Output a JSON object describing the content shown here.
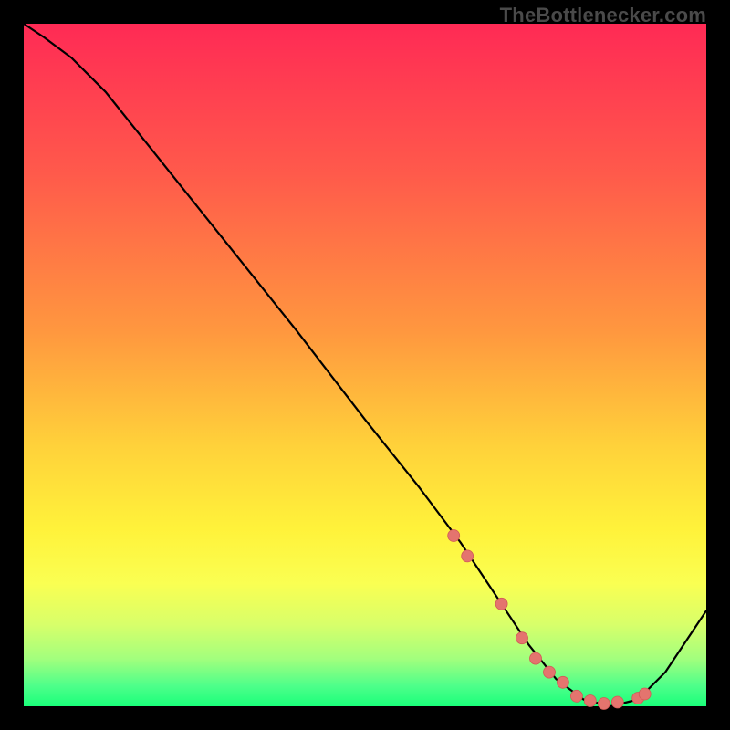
{
  "watermark": "TheBottlenecker.com",
  "gradient_stops": [
    {
      "pct": 0,
      "color": "#ff2a55"
    },
    {
      "pct": 22,
      "color": "#ff5a4b"
    },
    {
      "pct": 45,
      "color": "#ff973f"
    },
    {
      "pct": 62,
      "color": "#ffd23a"
    },
    {
      "pct": 74,
      "color": "#fff23a"
    },
    {
      "pct": 82,
      "color": "#faff52"
    },
    {
      "pct": 88,
      "color": "#d8ff6a"
    },
    {
      "pct": 93,
      "color": "#a3ff7d"
    },
    {
      "pct": 97,
      "color": "#4eff8a"
    },
    {
      "pct": 100,
      "color": "#1aff7a"
    }
  ],
  "marker_color": "#e4746e",
  "chart_data": {
    "type": "line",
    "title": "",
    "xlabel": "",
    "ylabel": "",
    "xlim": [
      0,
      100
    ],
    "ylim": [
      0,
      100
    ],
    "series": [
      {
        "name": "bottleneck-curve",
        "x": [
          0,
          3,
          7,
          12,
          20,
          30,
          40,
          50,
          58,
          64,
          70,
          74,
          78,
          82,
          86,
          90,
          94,
          100
        ],
        "y": [
          100,
          98,
          95,
          90,
          80,
          67.5,
          55,
          42,
          32,
          24,
          15,
          9,
          4,
          1,
          0,
          1,
          5,
          14
        ]
      }
    ],
    "markers": {
      "name": "highlight-points",
      "x": [
        63,
        65,
        70,
        73,
        75,
        77,
        79,
        81,
        83,
        85,
        87,
        90,
        91
      ],
      "y": [
        25,
        22,
        15,
        10,
        7,
        5,
        3.5,
        1.5,
        0.8,
        0.4,
        0.6,
        1.2,
        1.8
      ]
    }
  }
}
